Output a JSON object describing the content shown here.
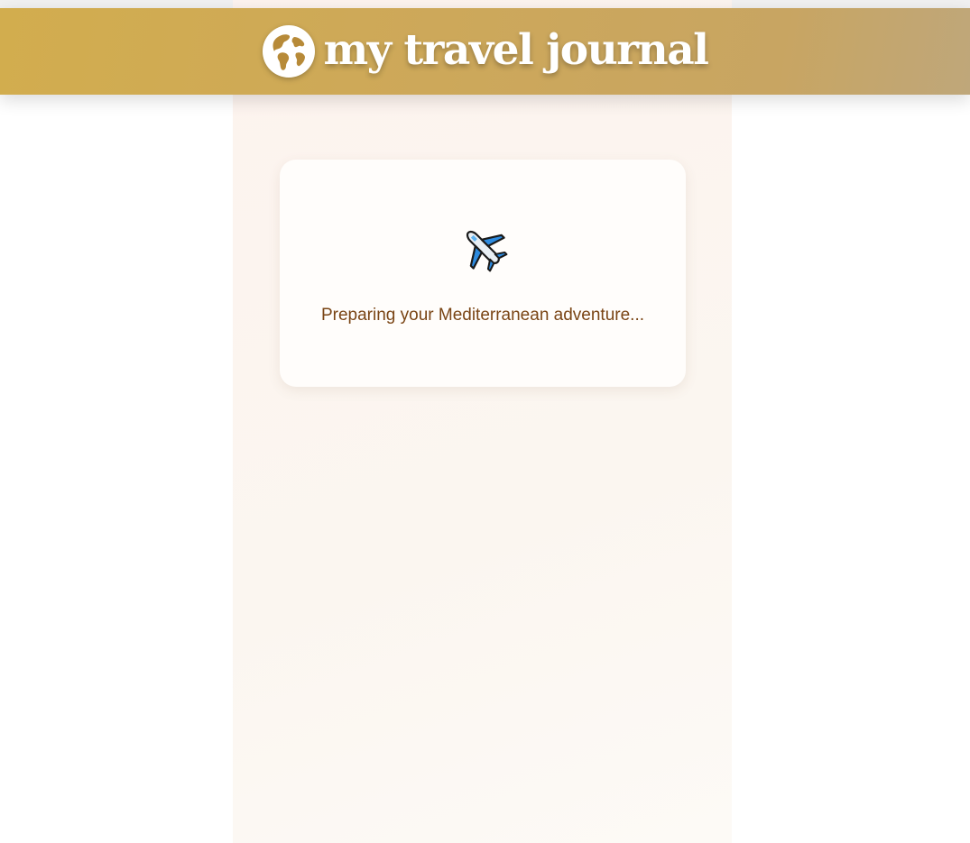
{
  "header": {
    "title": "my travel journal",
    "icon": "globe-icon",
    "colors": {
      "gradient_start": "#d2ad4e",
      "gradient_end": "#bfa77a",
      "title": "#ffffff"
    }
  },
  "loading_card": {
    "icon": "airplane-icon",
    "message": "Preparing your Mediterranean adventure...",
    "colors": {
      "background": "#fffdfb",
      "text": "#7a4515"
    }
  },
  "page": {
    "colors": {
      "background": "#ffffff",
      "column_background": "#fdf6f0"
    }
  }
}
